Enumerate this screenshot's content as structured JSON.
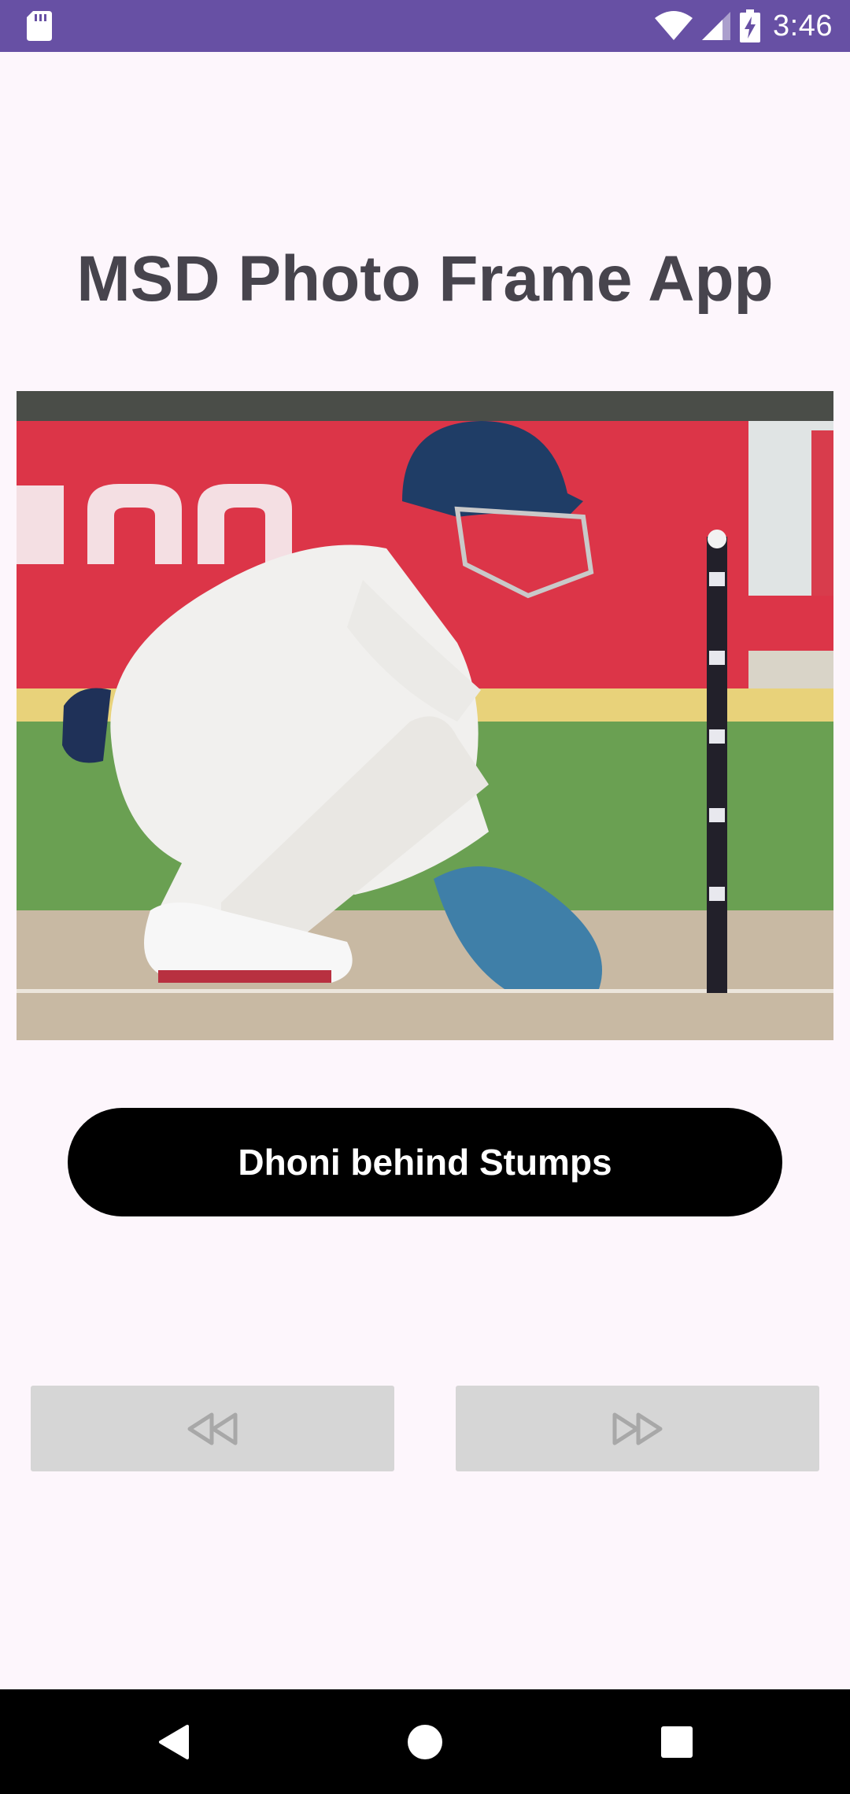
{
  "status_bar": {
    "time": "3:46",
    "icons": [
      "sd-card-icon",
      "wifi-icon",
      "cell-signal-icon",
      "battery-charging-icon"
    ],
    "background": "#6750a4"
  },
  "app": {
    "title": "MSD Photo Frame App"
  },
  "photo": {
    "alt": "Dhoni behind Stumps"
  },
  "caption_button": {
    "label": "Dhoni behind Stumps"
  },
  "controls": {
    "previous_icon": "rewind-icon",
    "next_icon": "fast-forward-icon"
  },
  "system_nav": {
    "icons": [
      "back-icon",
      "home-icon",
      "recents-icon"
    ]
  },
  "colors": {
    "page_background": "#fdf6fc",
    "title_text": "#47444d",
    "button_background": "#000000",
    "control_background": "#d6d6d6"
  }
}
